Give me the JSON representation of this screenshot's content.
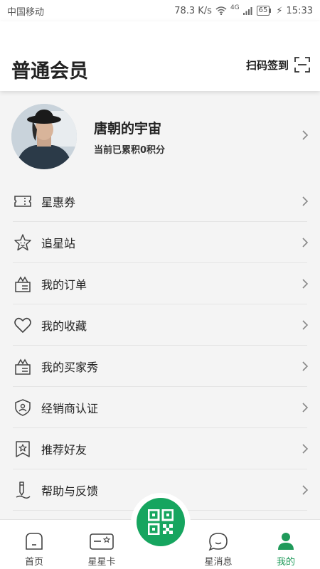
{
  "status_bar": {
    "carrier": "中国移动",
    "speed": "78.3 K/s",
    "network": "4G",
    "battery": "65",
    "time": "15:33"
  },
  "header": {
    "title": "普通会员",
    "scan_label": "扫码签到"
  },
  "profile": {
    "name": "唐朝的宇宙",
    "points_text": "当前已累积0积分"
  },
  "menu": {
    "items": [
      {
        "label": "星惠券",
        "icon": "ticket-icon"
      },
      {
        "label": "追星站",
        "icon": "star-face-icon"
      },
      {
        "label": "我的订单",
        "icon": "order-box-icon"
      },
      {
        "label": "我的收藏",
        "icon": "heart-icon"
      },
      {
        "label": "我的买家秀",
        "icon": "showcase-box-icon"
      },
      {
        "label": "经销商认证",
        "icon": "shield-icon"
      },
      {
        "label": "推荐好友",
        "icon": "bookmark-star-icon"
      },
      {
        "label": "帮助与反馈",
        "icon": "pen-icon"
      }
    ]
  },
  "tabbar": {
    "tabs": [
      {
        "label": "首页",
        "icon": "home-icon"
      },
      {
        "label": "星星卡",
        "icon": "card-icon"
      },
      {
        "label": "星消息",
        "icon": "message-icon"
      },
      {
        "label": "我的",
        "icon": "user-icon"
      }
    ],
    "active_index": 3,
    "fab_icon": "qr-code-icon"
  },
  "colors": {
    "accent": "#16a55f",
    "active_tab": "#1f9a5a",
    "background": "#f4f4f4"
  }
}
